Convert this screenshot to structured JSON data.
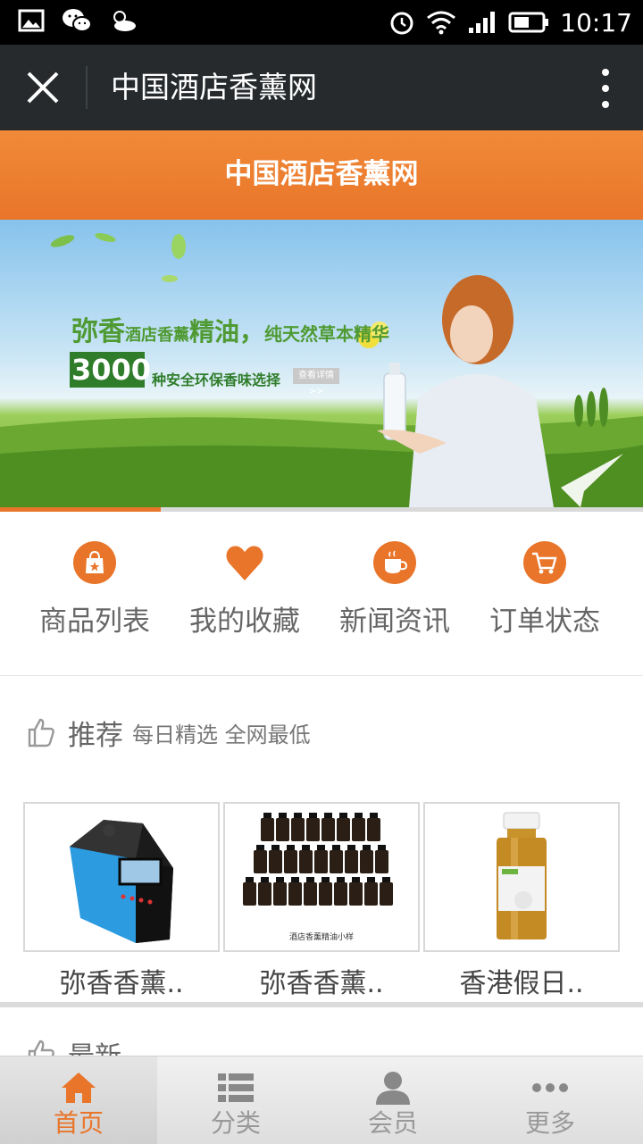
{
  "status_bar": {
    "time": "10:17"
  },
  "titlebar": {
    "title": "中国酒店香薰网"
  },
  "header": {
    "title": "中国酒店香薰网"
  },
  "banner": {
    "headline_brand": "弥香",
    "headline_mid": "酒店香薰",
    "headline_oil": "精油，",
    "headline_tail": "纯天然草本精华",
    "count": "3000",
    "count_text": "种安全环保香味选择",
    "button_label": "查看详情 >>",
    "progress": 0.25
  },
  "quick_menu": [
    {
      "label": "商品列表",
      "icon": "shopping-bag-icon"
    },
    {
      "label": "我的收藏",
      "icon": "heart-icon"
    },
    {
      "label": "新闻资讯",
      "icon": "coffee-cup-icon"
    },
    {
      "label": "订单状态",
      "icon": "cart-icon"
    }
  ],
  "recommend": {
    "title": "推荐",
    "subtitle": "每日精选 全网最低"
  },
  "products": [
    {
      "name": "弥香香薰..",
      "image": "diffuser-machine"
    },
    {
      "name": "弥香香薰..",
      "image": "essential-oil-samples",
      "caption": "酒店香薰精油小样"
    },
    {
      "name": "香港假日..",
      "image": "oil-bottle"
    }
  ],
  "latest": {
    "title": "最新"
  },
  "bottom_nav": [
    {
      "label": "首页",
      "icon": "home-icon",
      "active": true
    },
    {
      "label": "分类",
      "icon": "list-icon",
      "active": false
    },
    {
      "label": "会员",
      "icon": "user-icon",
      "active": false
    },
    {
      "label": "更多",
      "icon": "more-dots-icon",
      "active": false
    }
  ],
  "colors": {
    "accent": "#e9752a",
    "titlebar": "#262a2d"
  }
}
